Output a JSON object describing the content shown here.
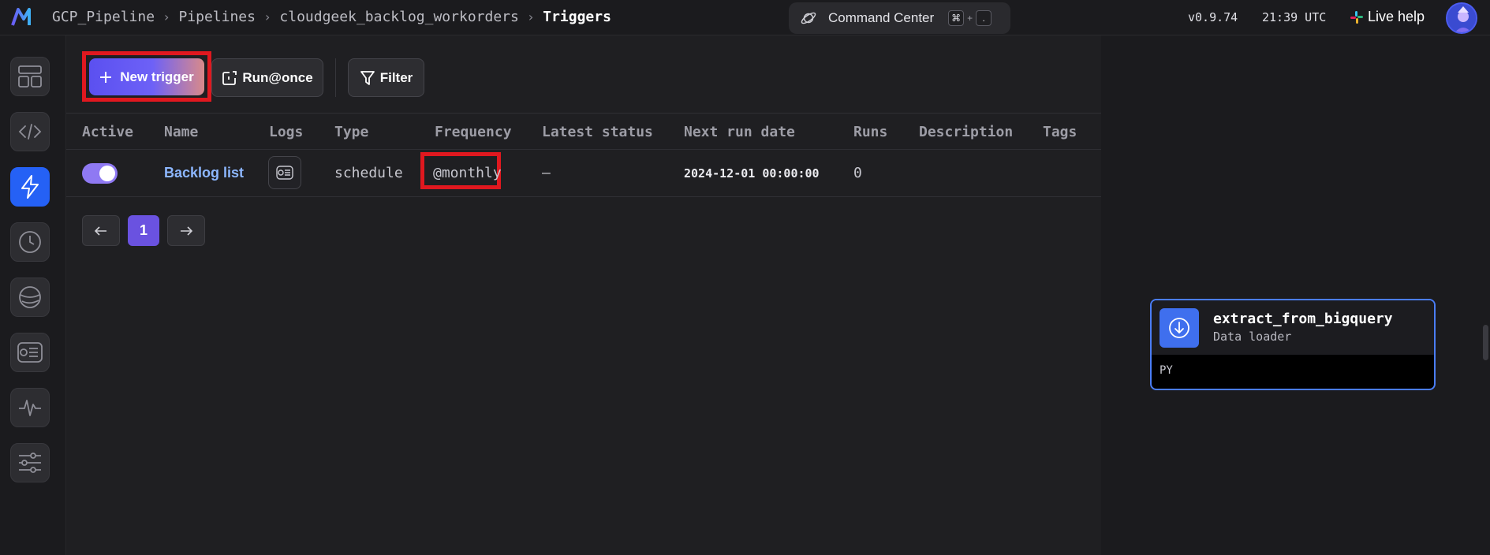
{
  "header": {
    "breadcrumb": [
      "GCP_Pipeline",
      "Pipelines",
      "cloudgeek_backlog_workorders",
      "Triggers"
    ],
    "command_center": {
      "label": "Command Center",
      "key1": "⌘",
      "plus": "+",
      "key2": "."
    },
    "version": "v0.9.74",
    "time": "21:39 UTC",
    "live_help": "Live help"
  },
  "sidebar": {
    "items": [
      {
        "name": "overview",
        "icon": "layout-icon"
      },
      {
        "name": "edit",
        "icon": "code-icon"
      },
      {
        "name": "triggers",
        "icon": "lightning-icon",
        "active": true
      },
      {
        "name": "runs",
        "icon": "clock-icon"
      },
      {
        "name": "backfills",
        "icon": "planet-icon"
      },
      {
        "name": "logs",
        "icon": "logs-icon"
      },
      {
        "name": "monitor",
        "icon": "pulse-icon"
      },
      {
        "name": "settings",
        "icon": "sliders-icon"
      }
    ]
  },
  "toolbar": {
    "new_trigger": "New trigger",
    "run_once": "Run@once",
    "filter": "Filter"
  },
  "table": {
    "columns": [
      "Active",
      "Name",
      "Logs",
      "Type",
      "Frequency",
      "Latest status",
      "Next run date",
      "Runs",
      "Description",
      "Tags"
    ],
    "rows": [
      {
        "active": true,
        "name": "Backlog list",
        "type": "schedule",
        "frequency": "@monthly",
        "latest_status": "—",
        "next_run_date": "2024-12-01 00:00:00",
        "runs": "0",
        "description": "",
        "tags": ""
      }
    ]
  },
  "pagination": {
    "current": "1"
  },
  "block": {
    "title": "extract_from_bigquery",
    "subtitle": "Data loader",
    "language": "PY"
  },
  "colors": {
    "accent": "#6a52e0",
    "active_nav": "#2561f5",
    "highlight": "#e0181f",
    "link": "#8db7ff"
  }
}
